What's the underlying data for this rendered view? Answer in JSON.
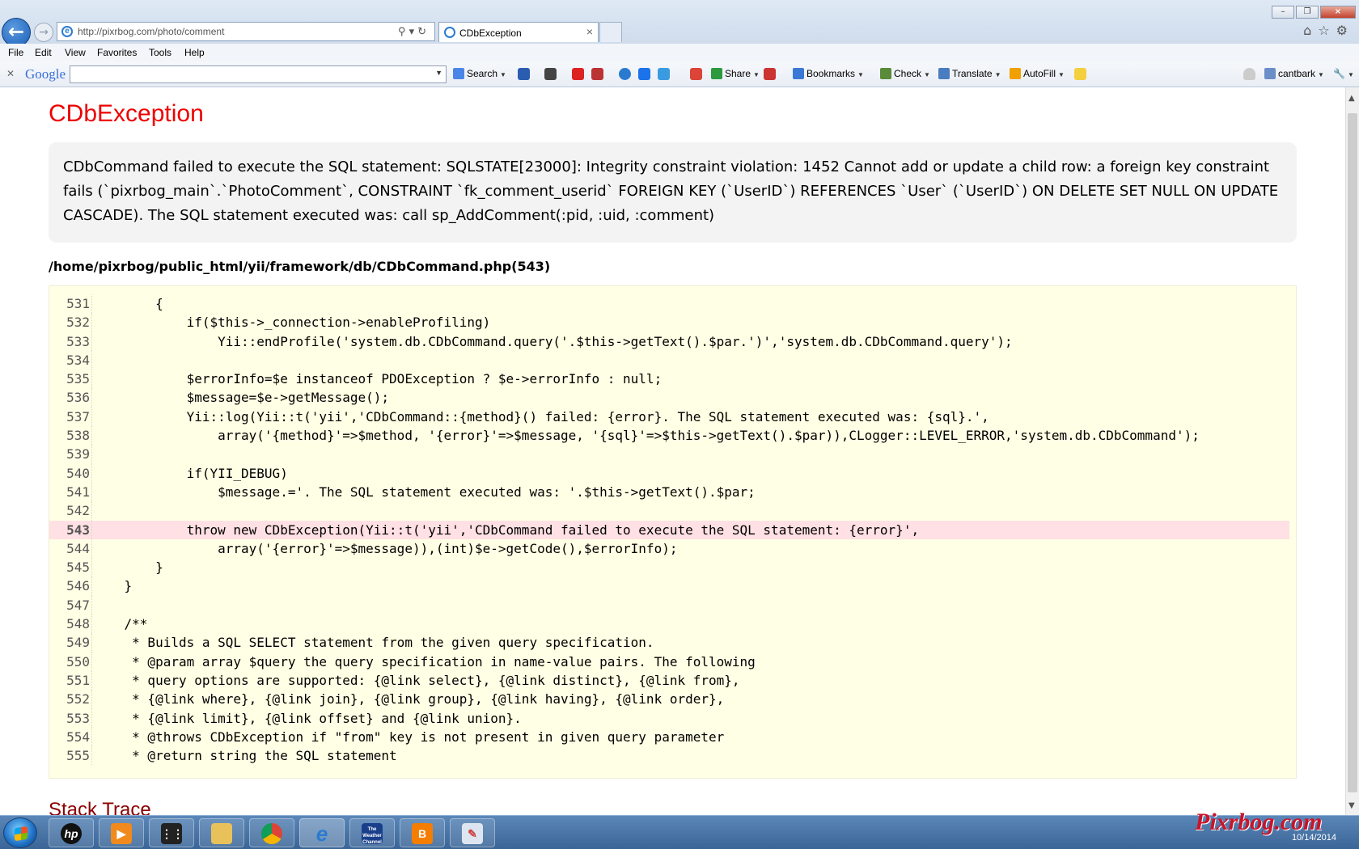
{
  "browser": {
    "address_url": "http://pixrbog.com/photo/comment",
    "tab_title": "CDbException",
    "menu": [
      "File",
      "Edit",
      "View",
      "Favorites",
      "Tools",
      "Help"
    ],
    "toolbar": {
      "google_label": "Google",
      "search_label": "Search",
      "share_label": "Share",
      "bookmarks_label": "Bookmarks",
      "check_label": "Check",
      "translate_label": "Translate",
      "autofill_label": "AutoFill",
      "account_label": "cantbark"
    }
  },
  "page": {
    "error_title": "CDbException",
    "error_message": "CDbCommand failed to execute the SQL statement: SQLSTATE[23000]: Integrity constraint violation: 1452 Cannot add or update a child row: a foreign key constraint fails (`pixrbog_main`.`PhotoComment`, CONSTRAINT `fk_comment_userid` FOREIGN KEY (`UserID`) REFERENCES `User` (`UserID`) ON DELETE SET NULL ON UPDATE CASCADE). The SQL statement executed was: call sp_AddComment(:pid, :uid, :comment)",
    "source_path": "/home/pixrbog/public_html/yii/framework/db/CDbCommand.php(543)",
    "error_line": 543,
    "code_lines": [
      {
        "n": "531",
        "code": "        {"
      },
      {
        "n": "532",
        "code": "            if($this->_connection->enableProfiling)"
      },
      {
        "n": "533",
        "code": "                Yii::endProfile('system.db.CDbCommand.query('.$this->getText().$par.')','system.db.CDbCommand.query');"
      },
      {
        "n": "534",
        "code": ""
      },
      {
        "n": "535",
        "code": "            $errorInfo=$e instanceof PDOException ? $e->errorInfo : null;"
      },
      {
        "n": "536",
        "code": "            $message=$e->getMessage();"
      },
      {
        "n": "537",
        "code": "            Yii::log(Yii::t('yii','CDbCommand::{method}() failed: {error}. The SQL statement executed was: {sql}.',"
      },
      {
        "n": "538",
        "code": "                array('{method}'=>$method, '{error}'=>$message, '{sql}'=>$this->getText().$par)),CLogger::LEVEL_ERROR,'system.db.CDbCommand');"
      },
      {
        "n": "539",
        "code": ""
      },
      {
        "n": "540",
        "code": "            if(YII_DEBUG)"
      },
      {
        "n": "541",
        "code": "                $message.='. The SQL statement executed was: '.$this->getText().$par;"
      },
      {
        "n": "542",
        "code": ""
      },
      {
        "n": "543",
        "code": "            throw new CDbException(Yii::t('yii','CDbCommand failed to execute the SQL statement: {error}',"
      },
      {
        "n": "544",
        "code": "                array('{error}'=>$message)),(int)$e->getCode(),$errorInfo);"
      },
      {
        "n": "545",
        "code": "        }"
      },
      {
        "n": "546",
        "code": "    }"
      },
      {
        "n": "547",
        "code": ""
      },
      {
        "n": "548",
        "code": "    /**"
      },
      {
        "n": "549",
        "code": "     * Builds a SQL SELECT statement from the given query specification."
      },
      {
        "n": "550",
        "code": "     * @param array $query the query specification in name-value pairs. The following"
      },
      {
        "n": "551",
        "code": "     * query options are supported: {@link select}, {@link distinct}, {@link from},"
      },
      {
        "n": "552",
        "code": "     * {@link where}, {@link join}, {@link group}, {@link having}, {@link order},"
      },
      {
        "n": "553",
        "code": "     * {@link limit}, {@link offset} and {@link union}."
      },
      {
        "n": "554",
        "code": "     * @throws CDbException if \"from\" key is not present in given query parameter"
      },
      {
        "n": "555",
        "code": "     * @return string the SQL statement"
      }
    ],
    "stack_trace_title": "Stack Trace"
  },
  "taskbar": {
    "apps": [
      "hp-icon",
      "media-player-icon",
      "blackberry-icon",
      "file-explorer-icon",
      "chrome-icon",
      "internet-explorer-icon",
      "weather-channel-icon",
      "blogger-icon",
      "paint-icon"
    ],
    "weather_label": "The Weather Channel",
    "blogger_label": "B",
    "hp_label": "hp",
    "clock_date": "10/14/2014"
  },
  "watermark": "Pixrbog.com",
  "colors": {
    "error_title": "#ee0000",
    "stack_title": "#8b0000",
    "code_bg": "#ffffe5",
    "error_line_bg": "#ffe0e4",
    "message_bg": "#f3f3f3"
  }
}
